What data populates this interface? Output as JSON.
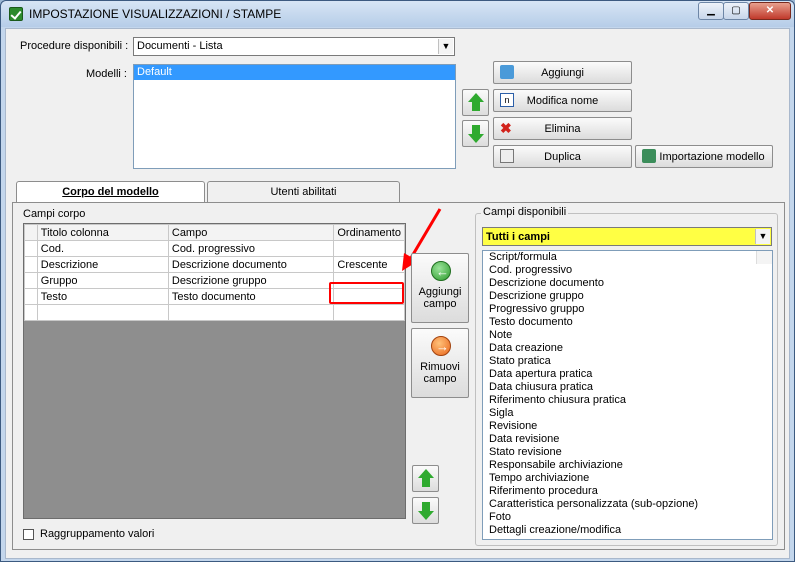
{
  "window": {
    "title": "IMPOSTAZIONE VISUALIZZAZIONI / STAMPE"
  },
  "top": {
    "procedure_label": "Procedure disponibili :",
    "procedure_value": "Documenti - Lista",
    "models_label": "Modelli :",
    "models": [
      "Default"
    ],
    "buttons": {
      "add": "Aggiungi",
      "rename": "Modifica nome",
      "delete": "Elimina",
      "duplicate": "Duplica",
      "import": "Importazione modello"
    }
  },
  "tabs": [
    "Corpo del modello",
    "Utenti abilitati"
  ],
  "body_fields": {
    "label": "Campi corpo",
    "columns": [
      "Titolo colonna",
      "Campo",
      "Ordinamento"
    ],
    "rows": [
      [
        "Cod.",
        "Cod. progressivo",
        ""
      ],
      [
        "Descrizione",
        "Descrizione documento",
        "Crescente"
      ],
      [
        "Gruppo",
        "Descrizione gruppo",
        ""
      ],
      [
        "Testo",
        "Testo documento",
        ""
      ]
    ]
  },
  "actions": {
    "add_field": "Aggiungi campo",
    "remove_field": "Rimuovi campo"
  },
  "grouping_label": "Raggruppamento valori",
  "available": {
    "label": "Campi disponibili",
    "filter": "Tutti i campi",
    "items": [
      "Script/formula",
      "Cod. progressivo",
      "Descrizione documento",
      "Descrizione gruppo",
      "Progressivo gruppo",
      "Testo documento",
      "Note",
      "Data creazione",
      "Stato pratica",
      "Data apertura pratica",
      "Data chiusura pratica",
      "Riferimento chiusura pratica",
      "Sigla",
      "Revisione",
      "Data revisione",
      "Stato revisione",
      "Responsabile archiviazione",
      "Tempo archiviazione",
      "Riferimento procedura",
      "Caratteristica personalizzata (sub-opzione)",
      "Foto",
      "Dettagli creazione/modifica"
    ]
  }
}
